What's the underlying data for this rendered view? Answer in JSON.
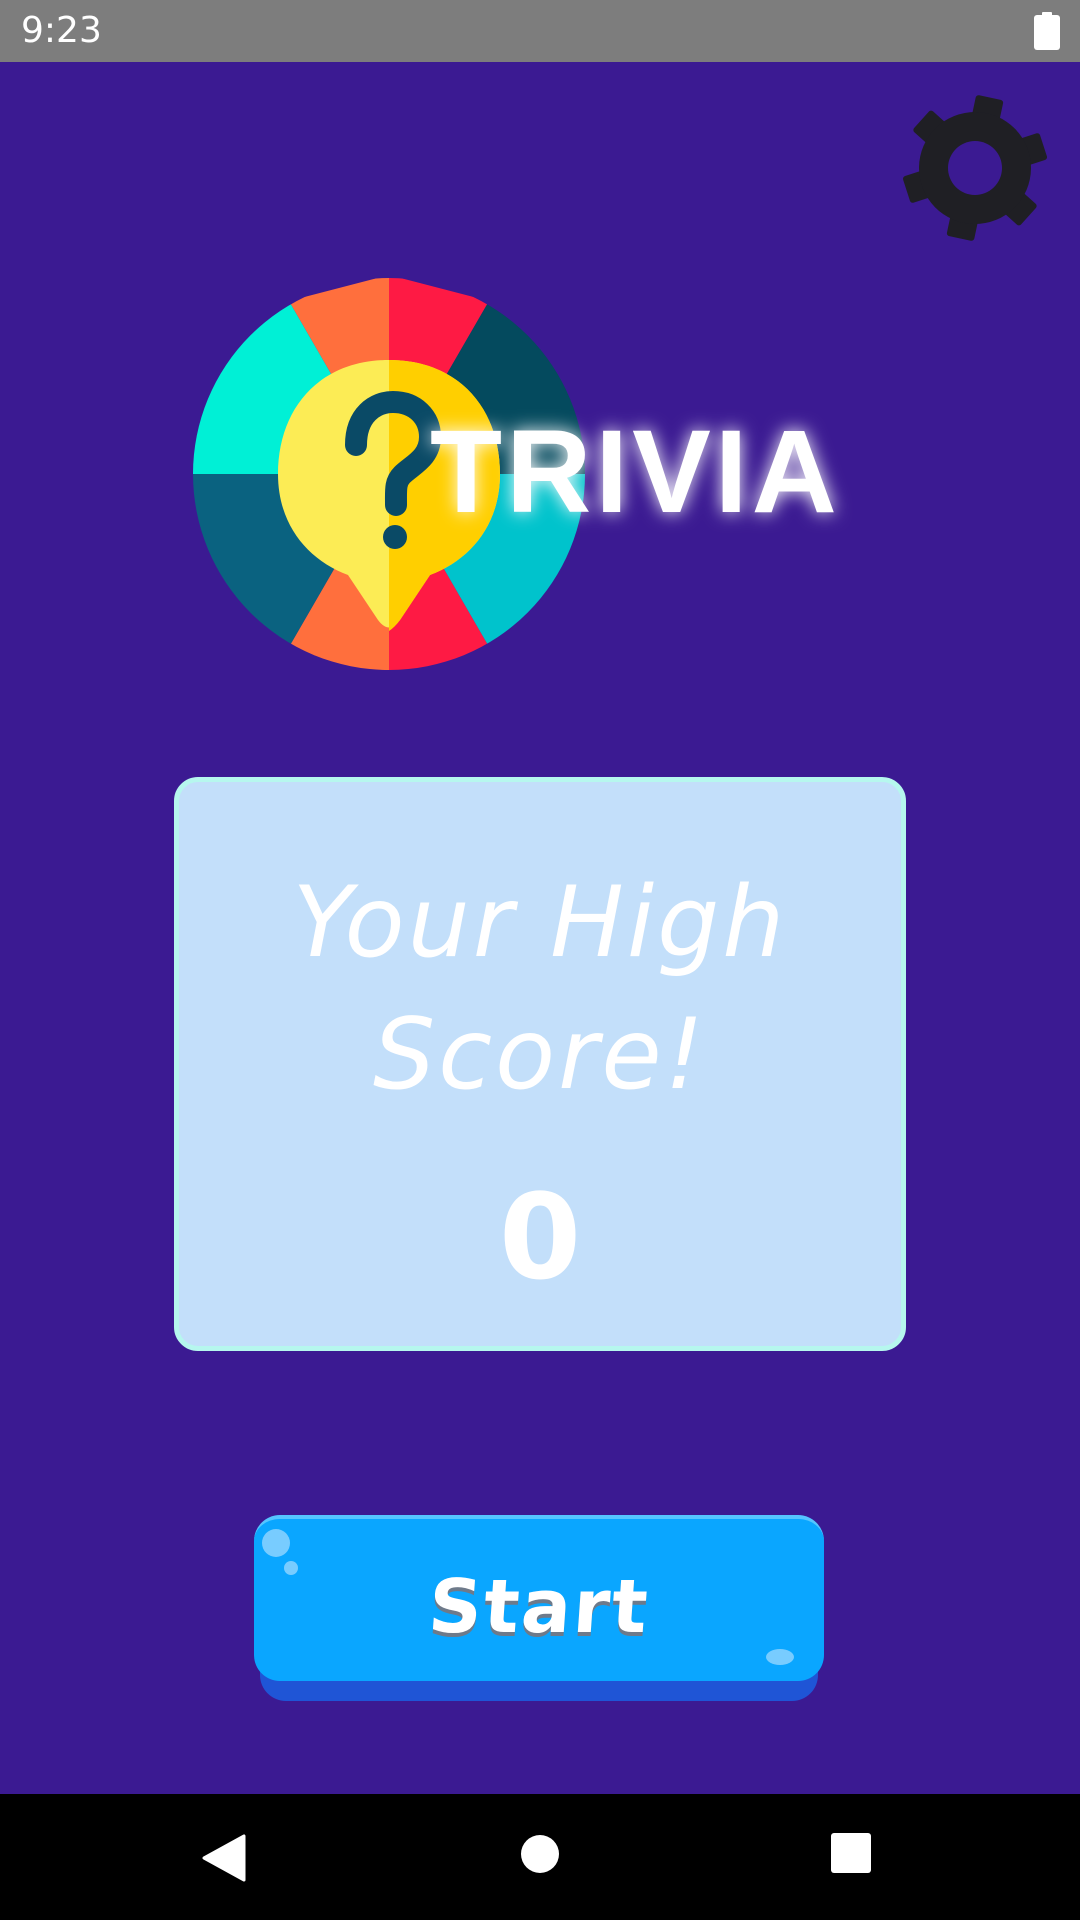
{
  "status_bar": {
    "time": "9:23",
    "battery_icon": "battery-full-icon"
  },
  "settings": {
    "icon": "gear-icon"
  },
  "logo": {
    "text": "TRIVIA",
    "icon": "question-bubble-wheel-icon"
  },
  "high_score": {
    "title": "Your High Score!",
    "value": "0"
  },
  "start_button": {
    "label": "Start"
  },
  "nav_bar": {
    "back_icon": "back-triangle-icon",
    "home_icon": "home-circle-icon",
    "recents_icon": "recents-square-icon"
  },
  "colors": {
    "background": "#3b1a92",
    "card_fill": "#c3dffa",
    "card_border": "#b6f7ee",
    "button_fill": "#0aa6ff",
    "button_shadow": "#1f55d6",
    "gear": "#1f1f24"
  }
}
